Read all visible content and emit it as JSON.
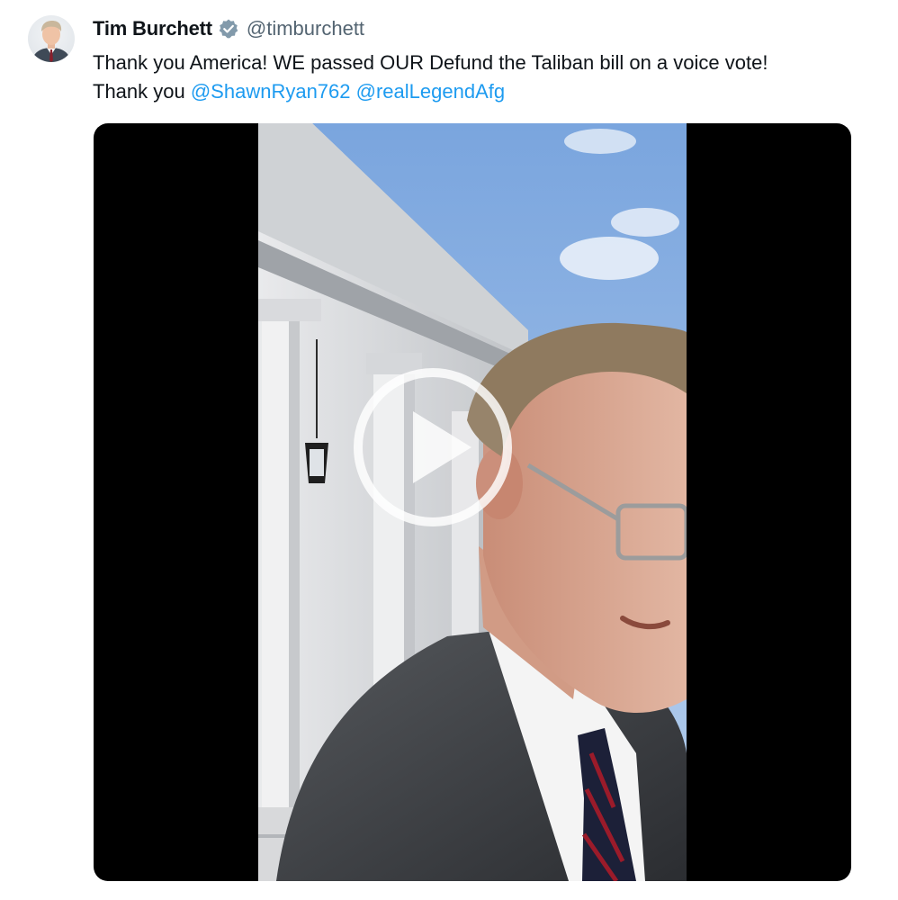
{
  "tweet": {
    "author_name": "Tim Burchett",
    "author_handle": "@timburchett",
    "text_line1": "Thank you America! WE passed OUR Defund the Taliban bill on a voice vote!",
    "text_line2_prefix": "Thank you ",
    "mentions": [
      "@ShawnRyan762",
      "@realLegendAfg"
    ]
  },
  "icons": {
    "verified": "verified-badge-icon",
    "play": "play-icon"
  },
  "colors": {
    "link": "#1d9bf0",
    "secondary_text": "#536471",
    "media_background": "#000000"
  }
}
